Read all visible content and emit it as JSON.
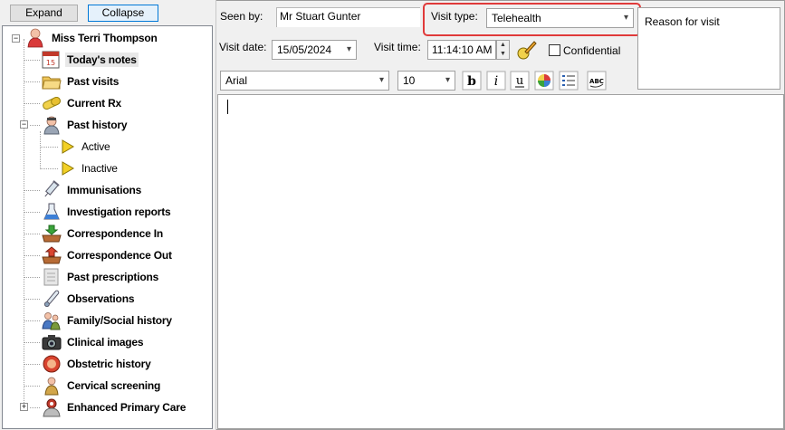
{
  "buttons": {
    "expand": "Expand",
    "collapse": "Collapse"
  },
  "tree": {
    "patient": "Miss Terri Thompson",
    "items": [
      {
        "label": "Today's notes",
        "icon": "calendar-icon"
      },
      {
        "label": "Past visits",
        "icon": "folder-icon"
      },
      {
        "label": "Current Rx",
        "icon": "capsule-icon"
      },
      {
        "label": "Past history",
        "icon": "doctor-icon"
      },
      {
        "label": "Active",
        "icon": "yellow-triangle-icon"
      },
      {
        "label": "Inactive",
        "icon": "yellow-triangle-icon"
      },
      {
        "label": "Immunisations",
        "icon": "syringe-icon"
      },
      {
        "label": "Investigation reports",
        "icon": "flask-icon"
      },
      {
        "label": "Correspondence In",
        "icon": "inbox-icon"
      },
      {
        "label": "Correspondence Out",
        "icon": "outbox-icon"
      },
      {
        "label": "Past prescriptions",
        "icon": "prescription-icon"
      },
      {
        "label": "Observations",
        "icon": "thermometer-icon"
      },
      {
        "label": "Family/Social history",
        "icon": "family-icon"
      },
      {
        "label": "Clinical images",
        "icon": "camera-icon"
      },
      {
        "label": "Obstetric history",
        "icon": "fetus-icon"
      },
      {
        "label": "Cervical screening",
        "icon": "person-icon"
      },
      {
        "label": "Enhanced Primary Care",
        "icon": "care-team-icon"
      }
    ]
  },
  "form": {
    "seen_by_label": "Seen by:",
    "seen_by_value": "Mr Stuart Gunter",
    "visit_type_label": "Visit type:",
    "visit_type_value": "Telehealth",
    "reason_label": "Reason for visit",
    "visit_date_label": "Visit date:",
    "visit_date_value": "15/05/2024",
    "visit_time_label": "Visit time:",
    "visit_time_value": "11:14:10 AM",
    "confidential_label": "Confidential"
  },
  "toolbar": {
    "font": "Arial",
    "size": "10",
    "tools": [
      "bold-icon",
      "italic-icon",
      "underline-icon",
      "color-icon",
      "list-icon",
      "spellcheck-icon"
    ]
  },
  "colors": {
    "highlight": "#e03a3a",
    "selection": "#e8e8e8",
    "accent": "#0078d7"
  }
}
